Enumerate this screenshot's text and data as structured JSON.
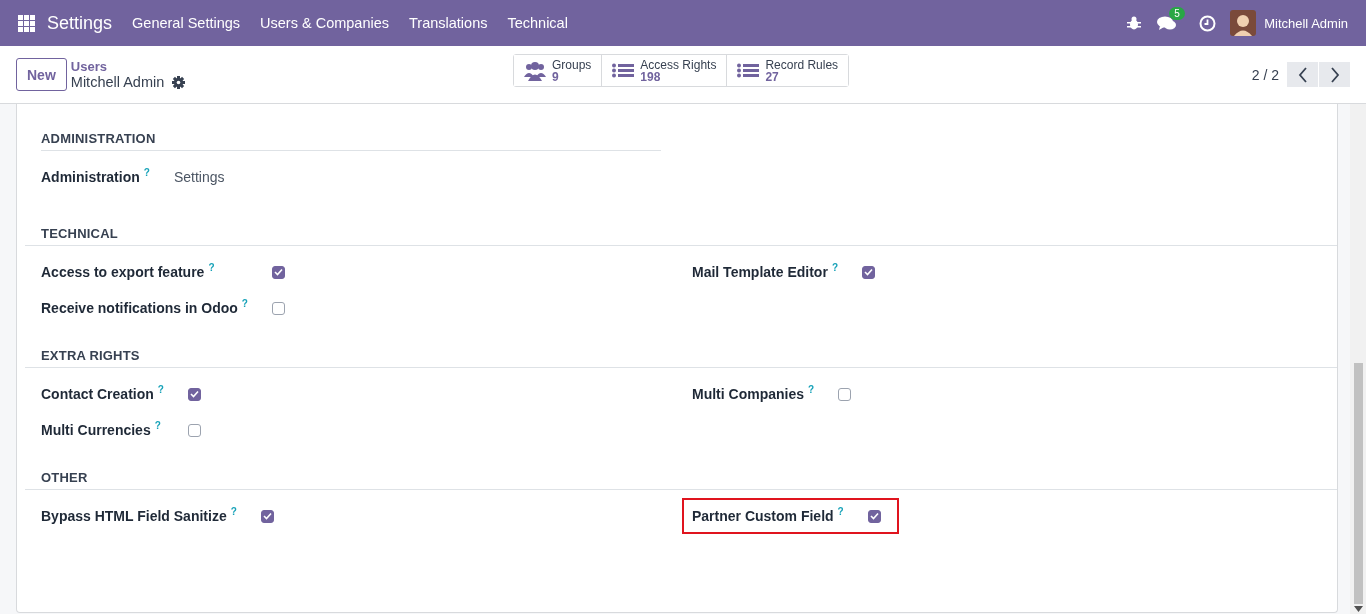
{
  "navbar": {
    "app": "Settings",
    "menus": [
      "General Settings",
      "Users & Companies",
      "Translations",
      "Technical"
    ],
    "messages_count": "5",
    "user": "Mitchell Admin"
  },
  "control_panel": {
    "new_button": "New",
    "breadcrumb": "Users",
    "record": "Mitchell Admin",
    "smart_buttons": [
      {
        "kind": "groups",
        "label": "Groups",
        "count": "9"
      },
      {
        "kind": "list",
        "label": "Access Rights",
        "count": "198"
      },
      {
        "kind": "list",
        "label": "Record Rules",
        "count": "27"
      }
    ],
    "pager": "2 / 2"
  },
  "sections": [
    {
      "title": "ADMINISTRATION",
      "kind": "selection",
      "columns": [
        [
          {
            "label": "Administration",
            "help": "?",
            "value": "Settings"
          }
        ]
      ]
    },
    {
      "title": "TECHNICAL",
      "kind": "checkboxes",
      "columns": [
        [
          {
            "label": "Access to export feature",
            "help": "?",
            "checked": true,
            "highlighted": false
          },
          {
            "label": "Receive notifications in Odoo",
            "help": "?",
            "checked": false,
            "highlighted": false
          }
        ],
        [
          {
            "label": "Mail Template Editor",
            "help": "?",
            "checked": true,
            "highlighted": false
          }
        ]
      ]
    },
    {
      "title": "EXTRA RIGHTS",
      "kind": "checkboxes",
      "columns": [
        [
          {
            "label": "Contact Creation",
            "help": "?",
            "checked": true,
            "highlighted": false
          },
          {
            "label": "Multi Currencies",
            "help": "?",
            "checked": false,
            "highlighted": false
          }
        ],
        [
          {
            "label": "Multi Companies",
            "help": "?",
            "checked": false,
            "highlighted": false
          }
        ]
      ]
    },
    {
      "title": "OTHER",
      "kind": "checkboxes",
      "columns": [
        [
          {
            "label": "Bypass HTML Field Sanitize",
            "help": "?",
            "checked": true,
            "highlighted": false
          }
        ],
        [
          {
            "label": "Partner Custom Field",
            "help": "?",
            "checked": true,
            "highlighted": true
          }
        ]
      ]
    }
  ]
}
